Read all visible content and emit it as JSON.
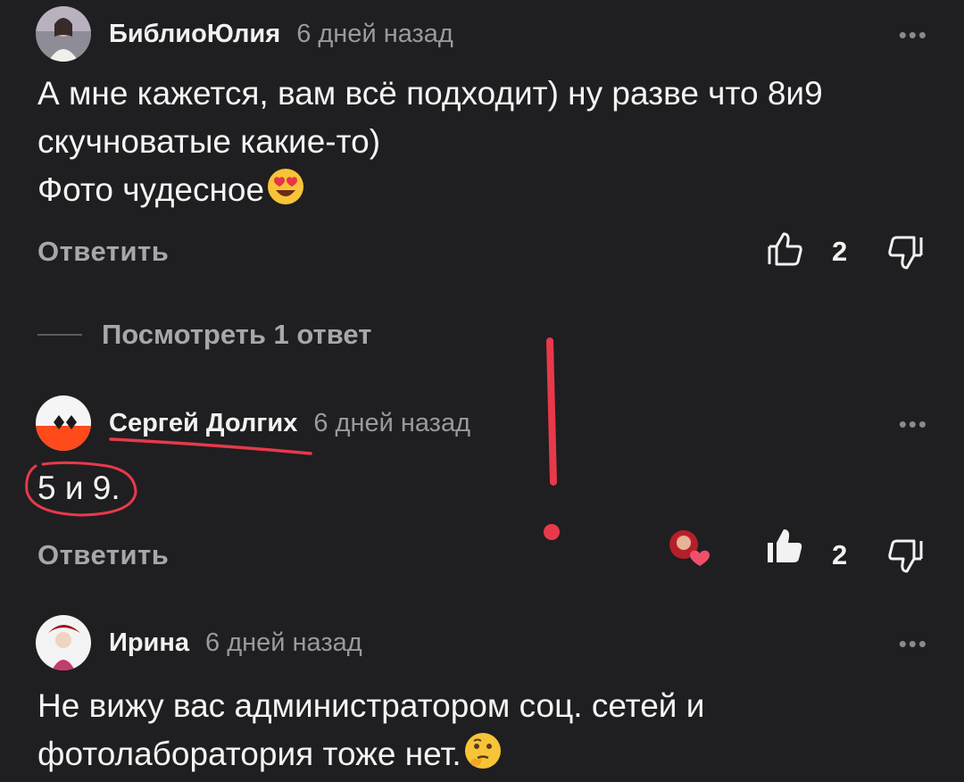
{
  "comments": [
    {
      "author": "БиблиоЮлия",
      "time": "6 дней назад",
      "text_lines": [
        "А мне кажется, вам всё подходит) ну разве что 8и9",
        "скучноватые какие-то)",
        "Фото чудесное"
      ],
      "text_emoji": "smiling-face-with-heart-eyes-icon",
      "reply_label": "Ответить",
      "likes": "2",
      "liked": false
    },
    {
      "author": "Сергей Долгих",
      "time": "6 дней назад",
      "text": "5 и 9.",
      "reply_label": "Ответить",
      "likes": "2",
      "liked": true,
      "liked_by_author_icon": "author-heart-icon"
    },
    {
      "author": "Ирина",
      "time": "6 дней назад",
      "text_lines": [
        "Не вижу вас администратором соц. сетей и",
        "фотолаборатория тоже нет."
      ],
      "text_emoji": "thinking-face-icon"
    }
  ],
  "view_replies_label": "Посмотреть 1 ответ",
  "more_label": "•••",
  "colors": {
    "background": "#1f1f21",
    "text": "#f2f2f2",
    "muted": "#9a9a9e",
    "annotation_red": "#e8394a"
  }
}
